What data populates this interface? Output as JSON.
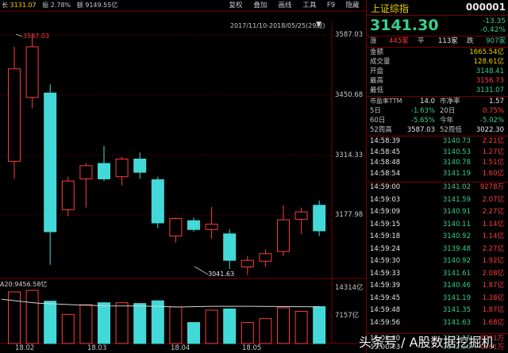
{
  "header": {
    "length_label": "长",
    "length_value": "3131.07",
    "amplitude_label": "振",
    "amplitude_value": "2.78%",
    "amount_label": "额",
    "amount_value": "9149.55亿"
  },
  "toolbar": [
    "复权",
    "叠加",
    "画线",
    "工具",
    "F9",
    "隐藏"
  ],
  "date_range": "2017/11/10-2018/05/25(29周)",
  "price_axis": [
    {
      "label": "3587.03",
      "value": 3587.03
    },
    {
      "label": "3450.68",
      "value": 3450.68
    },
    {
      "label": "3314.33",
      "value": 3314.33
    },
    {
      "label": "3177.98",
      "value": 3177.98
    }
  ],
  "high_marker": "3587.03",
  "low_marker": "3041.63",
  "volume_axis": [
    {
      "label": "14314亿",
      "value": 14314
    },
    {
      "label": "7157亿",
      "value": 7157
    }
  ],
  "ma_label": "A20:9456.58亿",
  "date_labels": [
    "18.02",
    "18.03",
    "18.04",
    "18.05"
  ],
  "chart_data": {
    "type": "candlestick",
    "ylim": [
      3020,
      3600
    ],
    "volume_ylim": [
      0,
      14314
    ],
    "candles": [
      {
        "open": 3300,
        "close": 3510,
        "high": 3560,
        "low": 3260,
        "volume": 13300
      },
      {
        "open": 3445,
        "close": 3560,
        "high": 3587.03,
        "low": 3420,
        "volume": 13700
      },
      {
        "open": 3455,
        "close": 3140,
        "high": 3475,
        "low": 3065,
        "volume": 10900
      },
      {
        "open": 3190,
        "close": 3255,
        "high": 3265,
        "low": 3175,
        "volume": 7500
      },
      {
        "open": 3260,
        "close": 3290,
        "high": 3295,
        "low": 3195,
        "volume": 10000
      },
      {
        "open": 3295,
        "close": 3260,
        "high": 3335,
        "low": 3255,
        "volume": 10500
      },
      {
        "open": 3265,
        "close": 3305,
        "high": 3310,
        "low": 3245,
        "volume": 10500
      },
      {
        "open": 3305,
        "close": 3275,
        "high": 3320,
        "low": 3260,
        "volume": 10300
      },
      {
        "open": 3258,
        "close": 3160,
        "high": 3265,
        "low": 3148,
        "volume": 11000
      },
      {
        "open": 3130,
        "close": 3170,
        "high": 3172,
        "low": 3115,
        "volume": 9400
      },
      {
        "open": 3165,
        "close": 3145,
        "high": 3172,
        "low": 3140,
        "volume": 5400
      },
      {
        "open": 3145,
        "close": 3157,
        "high": 3196,
        "low": 3124,
        "volume": 8600
      },
      {
        "open": 3135,
        "close": 3075,
        "high": 3145,
        "low": 3055,
        "volume": 8900
      },
      {
        "open": 3060,
        "close": 3075,
        "high": 3085,
        "low": 3041.63,
        "volume": 5400
      },
      {
        "open": 3073,
        "close": 3090,
        "high": 3100,
        "low": 3060,
        "volume": 6400
      },
      {
        "open": 3095,
        "close": 3167,
        "high": 3200,
        "low": 3085,
        "volume": 9200
      },
      {
        "open": 3168,
        "close": 3185,
        "high": 3195,
        "low": 3135,
        "volume": 8300
      },
      {
        "open": 3200,
        "close": 3142,
        "high": 3211,
        "low": 3130,
        "volume": 9500
      }
    ],
    "ma_line": [
      11400,
      10400,
      10000,
      9700,
      9650,
      9400,
      9600,
      9600,
      9500,
      9456.58
    ]
  },
  "quote": {
    "name": "上证综指",
    "code": "000001",
    "price": "3141.30",
    "change": "-13.35",
    "change_pct": "-0.42%",
    "up_label": "涨",
    "up_count": "445家",
    "flat_label": "平",
    "flat_count": "113家",
    "down_label": "跌",
    "down_count": "907家"
  },
  "stats": [
    {
      "label": "金额",
      "value": "1665.54亿",
      "color": "#f0d000"
    },
    {
      "label": "成交量",
      "value": "128.61亿",
      "color": "#f0d000"
    },
    {
      "label": "开盘",
      "value": "3148.41",
      "color": "#37d08c"
    },
    {
      "label": "最高",
      "value": "3156.73",
      "color": "#ff3b3b"
    },
    {
      "label": "最低",
      "value": "3131.07",
      "color": "#37d08c"
    }
  ],
  "ratios": [
    {
      "l1": "市盈率TTM",
      "v1": "14.0",
      "c1": "#e8e8e8",
      "l2": "市净率",
      "v2": "1.57",
      "c2": "#e8e8e8"
    },
    {
      "l1": "5日",
      "v1": "-1.63%",
      "c1": "#37d08c",
      "l2": "20日",
      "v2": "0.75%",
      "c2": "#ff3b3b"
    },
    {
      "l1": "60日",
      "v1": "-5.65%",
      "c1": "#37d08c",
      "l2": "今年",
      "v2": "-5.02%",
      "c2": "#37d08c"
    },
    {
      "l1": "52周高",
      "v1": "3587.03",
      "c1": "#e8e8e8",
      "l2": "52周低",
      "v2": "3022.30",
      "c2": "#e8e8e8"
    }
  ],
  "ticks_a": [
    {
      "time": "14:58:39",
      "price": "3140.73",
      "vol": "2.21亿"
    },
    {
      "time": "14:58:45",
      "price": "3140.53",
      "vol": "1.27亿"
    },
    {
      "time": "14:58:48",
      "price": "3140.78",
      "vol": "1.51亿"
    },
    {
      "time": "14:58:54",
      "price": "3141.19",
      "vol": "1.60亿"
    }
  ],
  "ticks_b": [
    {
      "time": "14:59:00",
      "price": "3141.02",
      "vol": "9278万"
    },
    {
      "time": "14:59:03",
      "price": "3141.59",
      "vol": "2.07亿"
    },
    {
      "time": "14:59:09",
      "price": "3140.91",
      "vol": "2.27亿"
    },
    {
      "time": "14:59:15",
      "price": "3140.11",
      "vol": "1.14亿"
    },
    {
      "time": "14:59:18",
      "price": "3140.92",
      "vol": "1.14亿"
    },
    {
      "time": "14:59:24",
      "price": "3139.48",
      "vol": "2.27亿"
    },
    {
      "time": "14:59:30",
      "price": "3140.92",
      "vol": "1.92亿"
    },
    {
      "time": "14:59:33",
      "price": "3141.61",
      "vol": "2.08亿"
    },
    {
      "time": "14:59:39",
      "price": "3140.46",
      "vol": "1.87亿"
    },
    {
      "time": "14:59:45",
      "price": "3141.19",
      "vol": "1.38亿"
    },
    {
      "time": "14:59:48",
      "price": "3141.35",
      "vol": "1.87亿"
    },
    {
      "time": "14:59:56",
      "price": "3141.63",
      "vol": "1.68亿"
    }
  ],
  "ticks_c": [
    {
      "time": "15:00:00",
      "price": "3142.15",
      "vol": "8761万"
    },
    {
      "time": "15:00:03",
      "price": "3142.20",
      "vol": "6061万"
    }
  ],
  "watermark": "头条号 / A股数据挖掘机",
  "colors": {
    "up": "#ff3b3b",
    "down": "#44d9d9",
    "grid": "#7a0000",
    "ma": "#d4d4d4"
  }
}
